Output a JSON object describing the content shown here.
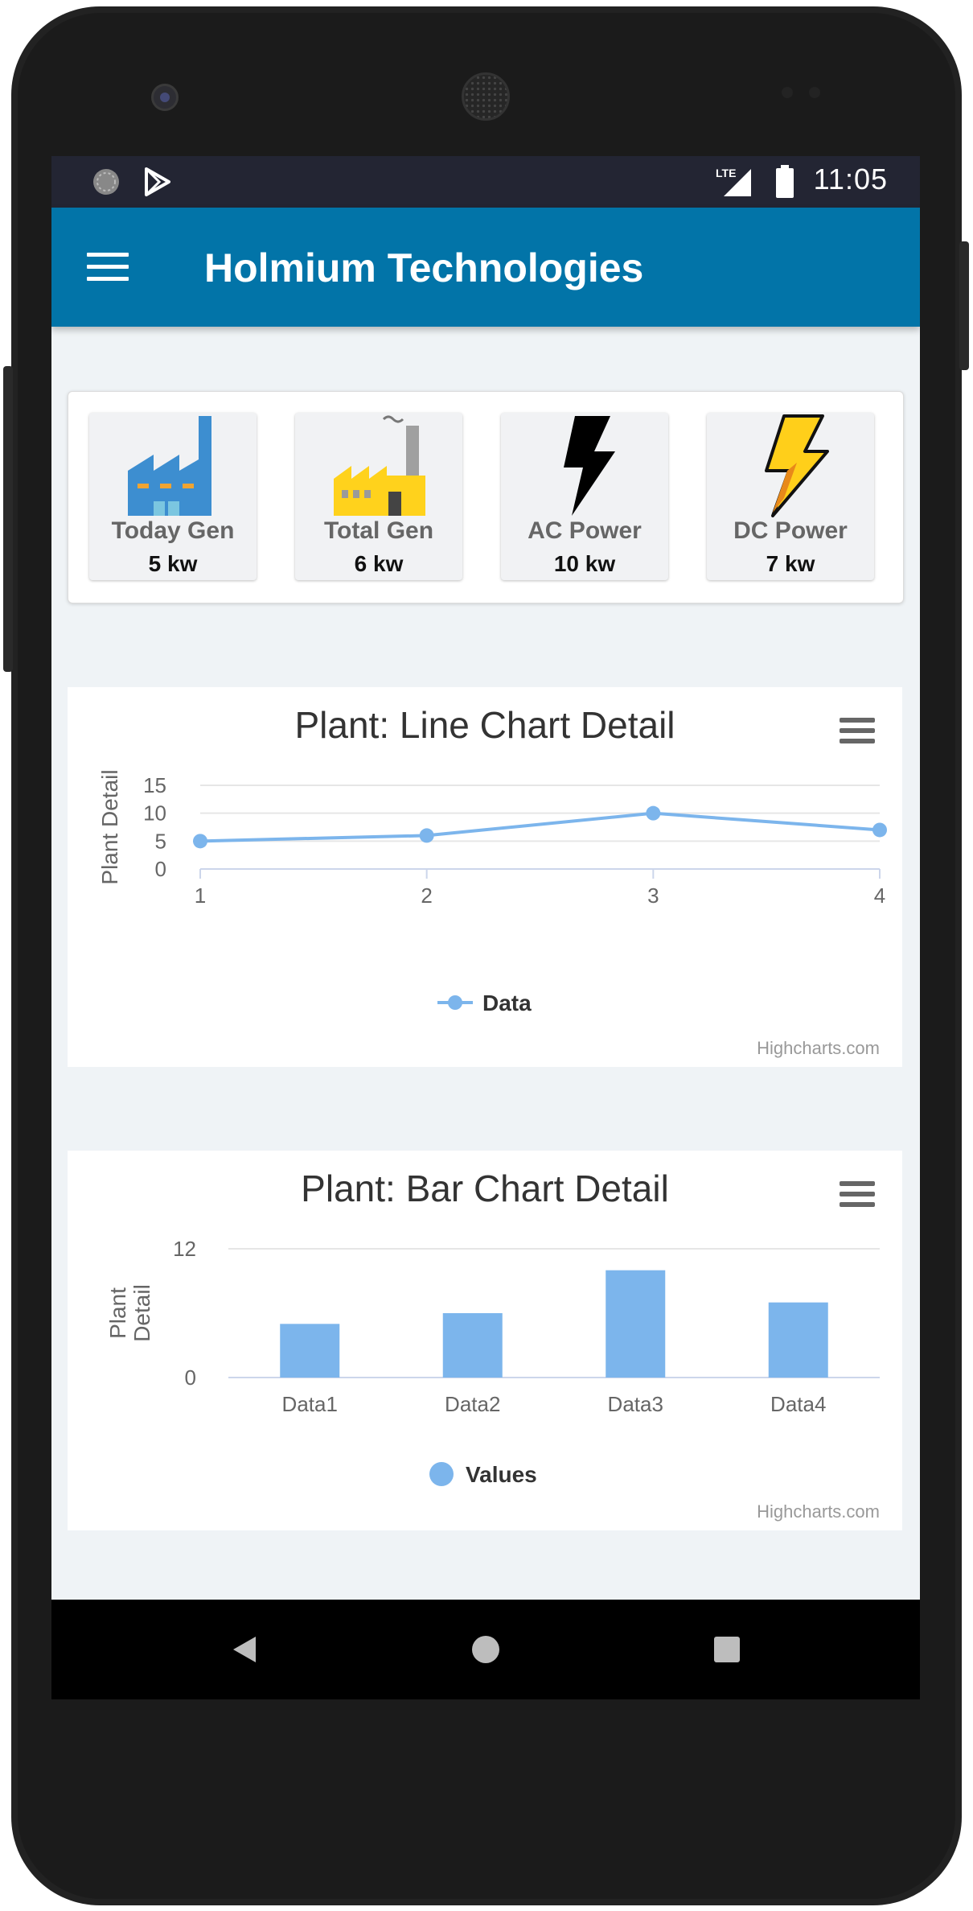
{
  "status_bar": {
    "time": "11:05",
    "network": "LTE"
  },
  "app_bar": {
    "title": "Holmium Technologies",
    "menu_icon": "hamburger-menu-icon"
  },
  "stats": [
    {
      "label": "Today Gen",
      "value": "5 kw",
      "icon": "factory-blue-icon"
    },
    {
      "label": "Total Gen",
      "value": "6 kw",
      "icon": "factory-yellow-icon"
    },
    {
      "label": "AC Power",
      "value": "10 kw",
      "icon": "lightning-black-icon"
    },
    {
      "label": "DC Power",
      "value": "7 kw",
      "icon": "lightning-yellow-icon"
    }
  ],
  "line_chart": {
    "credits": "Highcharts.com",
    "chart_data": {
      "type": "line",
      "title": "Plant: Line Chart Detail",
      "xlabel": "",
      "ylabel": "Plant Detail",
      "x": [
        1,
        2,
        3,
        4
      ],
      "yticks": [
        0,
        5,
        10,
        15
      ],
      "ylim": [
        0,
        15
      ],
      "series": [
        {
          "name": "Data",
          "values": [
            5,
            6,
            10,
            7
          ]
        }
      ],
      "legend": "bottom-center",
      "grid": true,
      "color": "#7cb5ec"
    }
  },
  "bar_chart": {
    "credits": "Highcharts.com",
    "chart_data": {
      "type": "bar",
      "title": "Plant: Bar Chart Detail",
      "xlabel": "",
      "ylabel": "Plant Detail",
      "categories": [
        "Data1",
        "Data2",
        "Data3",
        "Data4"
      ],
      "yticks": [
        0,
        12
      ],
      "ylim": [
        0,
        12
      ],
      "series": [
        {
          "name": "Values",
          "values": [
            5,
            6,
            10,
            7
          ]
        }
      ],
      "legend": "bottom-center",
      "grid": true,
      "color": "#7cb5ec"
    }
  },
  "nav_bar": {
    "back_icon": "back-triangle-icon",
    "home_icon": "home-circle-icon",
    "recents_icon": "recents-square-icon"
  }
}
